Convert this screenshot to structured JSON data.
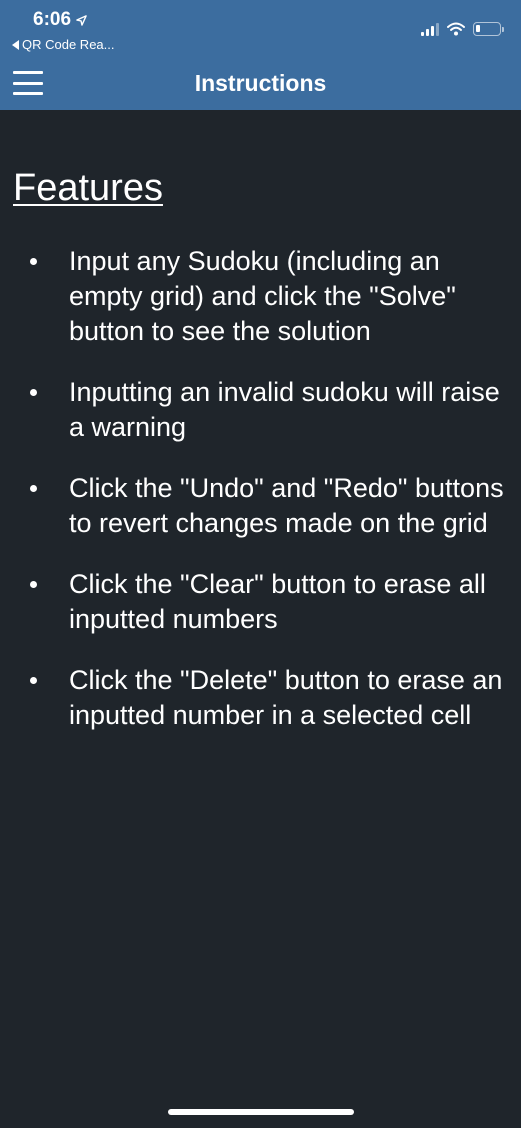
{
  "status_bar": {
    "time": "6:06",
    "back_app": "QR Code Rea...",
    "icons": [
      "location-arrow-icon",
      "cellular-signal-icon",
      "wifi-icon",
      "battery-icon"
    ]
  },
  "header": {
    "title": "Instructions",
    "menu_icon": "hamburger-menu-icon",
    "background_color": "#3c6d9f"
  },
  "main": {
    "heading": "Features",
    "background_color": "#1f252b",
    "features": [
      {
        "text": "Input any Sudoku (including an empty grid) and click the \"Solve\" button to see the solution"
      },
      {
        "text": "Inputting an invalid sudoku will raise a warning"
      },
      {
        "text": "Click the \"Undo\" and \"Redo\" buttons to revert changes made on the grid"
      },
      {
        "text": "Click the \"Clear\" button to erase all inputted numbers"
      },
      {
        "text": "Click the \"Delete\" button to erase an inputted number in a selected cell"
      }
    ]
  }
}
